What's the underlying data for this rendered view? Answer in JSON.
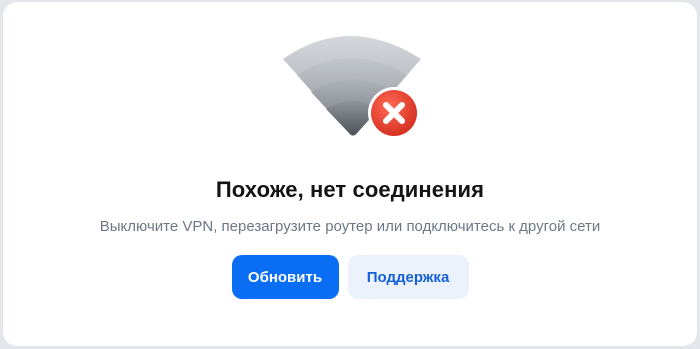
{
  "illustration": {
    "icon": "wifi-signal-icon",
    "badge_icon": "error-x-icon",
    "colors": {
      "signal": "#a9adb3",
      "badge": "#ea3a2a"
    }
  },
  "message": {
    "title": "Похоже, нет соединения",
    "subtitle": "Выключите VPN, перезагрузите роутер или подключитесь к другой сети"
  },
  "actions": {
    "refresh_label": "Обновить",
    "support_label": "Поддержка"
  },
  "colors": {
    "accent": "#0a6ef5",
    "secondary_bg": "#ebf2fc",
    "secondary_text": "#1561d5"
  }
}
